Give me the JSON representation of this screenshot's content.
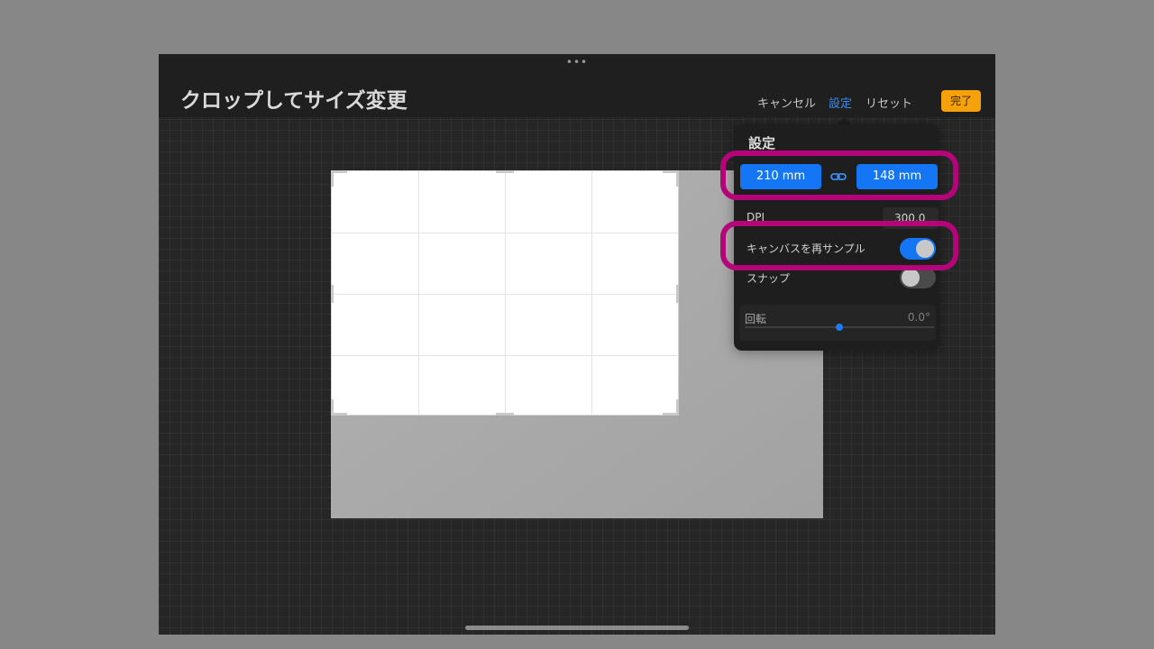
{
  "header": {
    "title": "クロップしてサイズ変更",
    "dots": "•••",
    "cancel_label": "キャンセル",
    "settings_label": "設定",
    "reset_label": "リセット",
    "done_label": "完了"
  },
  "settings_panel": {
    "title": "設定",
    "width_value": "210 mm",
    "height_value": "148 mm",
    "link_icon": "link-icon",
    "dpi_label": "DPI",
    "dpi_value": "300.0",
    "resample_label": "キャンバスを再サンプル",
    "resample_on": true,
    "snap_label": "スナップ",
    "snap_on": false,
    "rotation_label": "回転",
    "rotation_value": "0.0°",
    "rotation_position": 0.5
  },
  "colors": {
    "accent": "#1476f5",
    "done_button": "#f5a20a",
    "highlight": "#b5047a"
  }
}
